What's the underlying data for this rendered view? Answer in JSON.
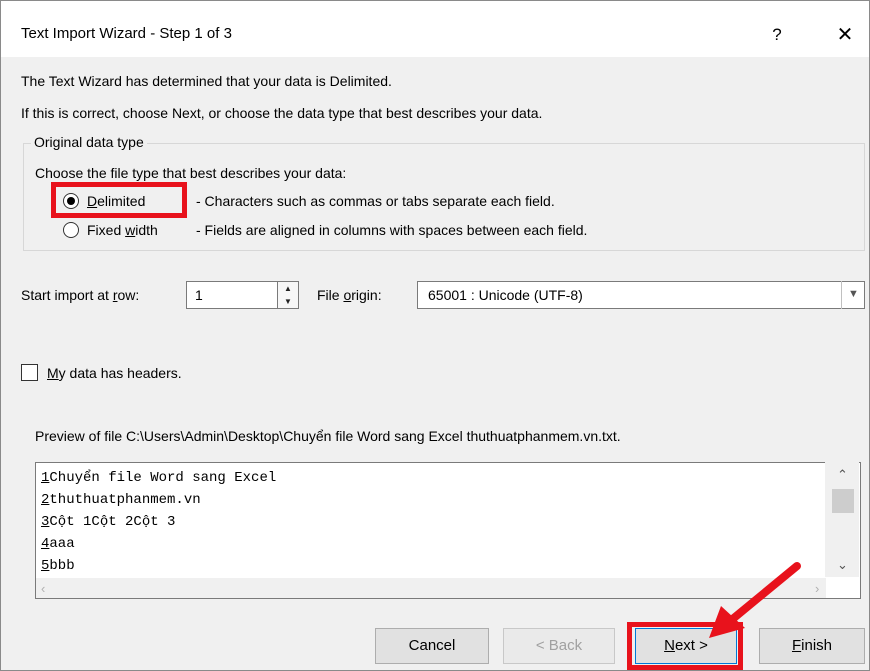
{
  "window": {
    "title": "Text Import Wizard - Step 1 of 3",
    "help_label": "?",
    "close_label": "✕"
  },
  "intro": {
    "line1": "The Text Wizard has determined that your data is Delimited.",
    "line2": "If this is correct, choose Next, or choose the data type that best describes your data."
  },
  "original_data_type": {
    "group_label": "Original data type",
    "prompt": "Choose the file type that best describes your data:",
    "options": [
      {
        "label_pre": "",
        "label_key": "D",
        "label_post": "elimited",
        "description": "- Characters such as commas or tabs separate each field.",
        "selected": true
      },
      {
        "label_pre": "Fixed ",
        "label_key": "w",
        "label_post": "idth",
        "description": "- Fields are aligned in columns with spaces between each field.",
        "selected": false
      }
    ]
  },
  "start_row": {
    "label_pre": "Start import at ",
    "label_key": "r",
    "label_post": "ow:",
    "value": "1"
  },
  "file_origin": {
    "label_pre": "File ",
    "label_key": "o",
    "label_post": "rigin:",
    "value": "65001 : Unicode (UTF-8)"
  },
  "headers_checkbox": {
    "label_key": "M",
    "label_post": "y data has headers.",
    "checked": false
  },
  "preview": {
    "label": "Preview of file C:\\Users\\Admin\\Desktop\\Chuyển file Word sang Excel thuthuatphanmem.vn.txt.",
    "lines": [
      {
        "num": "1",
        "text": "Chuyển file Word sang Excel"
      },
      {
        "num": "2",
        "text": "thuthuatphanmem.vn"
      },
      {
        "num": "3",
        "text": "Cột 1Cột 2Cột 3"
      },
      {
        "num": "4",
        "text": "aaa"
      },
      {
        "num": "5",
        "text": "bbb"
      }
    ]
  },
  "buttons": {
    "cancel": "Cancel",
    "back": "< Back",
    "next": "Next >",
    "finish": "Finish"
  },
  "annotation_color": "#e8121c"
}
